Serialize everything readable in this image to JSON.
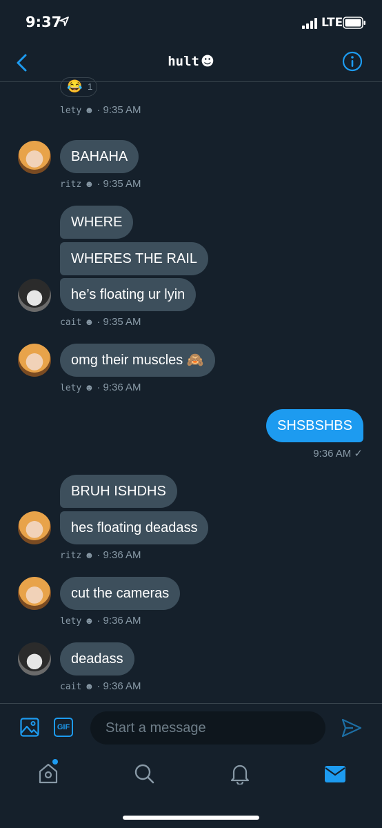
{
  "status": {
    "time": "9:37",
    "network": "LTE"
  },
  "header": {
    "title": "hult",
    "title_emoji": "☻"
  },
  "reaction": {
    "emoji": "😂",
    "count": "1"
  },
  "messages": [
    {
      "sender": "lety",
      "time": "9:35 AM"
    },
    {
      "sender": "ritz",
      "bubbles": [
        "BAHAHA"
      ],
      "time": "9:35 AM"
    },
    {
      "sender": "cait",
      "bubbles": [
        "WHERE",
        "WHERES THE RAIL",
        "he’s floating ur lyin"
      ],
      "time": "9:35 AM"
    },
    {
      "sender": "lety",
      "bubbles": [
        "omg their muscles 🙈"
      ],
      "time": "9:36 AM"
    },
    {
      "sender": "me",
      "bubbles": [
        "SHSBSHBS"
      ],
      "time": "9:36 AM ✓"
    },
    {
      "sender": "ritz",
      "bubbles": [
        "BRUH ISHDHS",
        "hes floating deadass"
      ],
      "time": "9:36 AM"
    },
    {
      "sender": "lety",
      "bubbles": [
        "cut the cameras"
      ],
      "time": "9:36 AM"
    },
    {
      "sender": "cait",
      "bubbles": [
        "deadass"
      ],
      "time": "9:36 AM"
    }
  ],
  "meta_separator": "·",
  "sender_emoji": "☻",
  "composer": {
    "placeholder": "Start a message",
    "gif_label": "GIF"
  },
  "colors": {
    "background": "#15202b",
    "accent": "#1d9bf0",
    "bubble": "#3d4f5c"
  }
}
